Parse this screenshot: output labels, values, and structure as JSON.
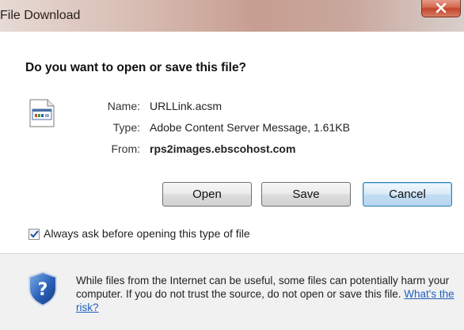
{
  "window": {
    "title": "File Download",
    "close_icon": "close-icon"
  },
  "dialog": {
    "question": "Do you want to open or save this file?",
    "file_icon": "document-icon",
    "fields": {
      "name_label": "Name:",
      "name_value": "URLLink.acsm",
      "type_label": "Type:",
      "type_value": "Adobe Content Server Message, 1.61KB",
      "from_label": "From:",
      "from_value": "rps2images.ebscohost.com"
    },
    "buttons": {
      "open": "Open",
      "save": "Save",
      "cancel": "Cancel"
    },
    "always_ask": {
      "label": "Always ask before opening this type of file",
      "checked": true
    }
  },
  "footer": {
    "shield_icon": "security-shield-icon",
    "warning_text": "While files from the Internet can be useful, some files can potentially harm your computer. If you do not trust the source, do not open or save this file.",
    "risk_link": "What's the risk?"
  },
  "colors": {
    "accent": "#3c7fb1",
    "link": "#1f5fbf",
    "close": "#c4452c"
  }
}
